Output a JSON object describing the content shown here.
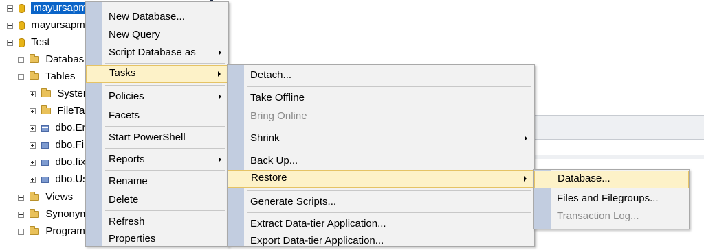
{
  "tree": {
    "rows": [
      {
        "label": "mayursapm",
        "indent": 0,
        "icon": "database-icon",
        "expander": "plus",
        "selected": true
      },
      {
        "label": "mayursapm",
        "indent": 0,
        "icon": "database-icon",
        "expander": "plus"
      },
      {
        "label": "Test",
        "indent": 0,
        "icon": "database-icon",
        "expander": "minus"
      },
      {
        "label": "Database",
        "indent": 1,
        "icon": "folder-icon",
        "expander": "plus"
      },
      {
        "label": "Tables",
        "indent": 1,
        "icon": "folder-icon",
        "expander": "minus"
      },
      {
        "label": "System",
        "indent": 2,
        "icon": "folder-icon",
        "expander": "plus"
      },
      {
        "label": "FileTab",
        "indent": 2,
        "icon": "folder-icon",
        "expander": "plus"
      },
      {
        "label": "dbo.Er",
        "indent": 2,
        "icon": "table-icon",
        "expander": "plus"
      },
      {
        "label": "dbo.Fi",
        "indent": 2,
        "icon": "table-icon",
        "expander": "plus"
      },
      {
        "label": "dbo.fix",
        "indent": 2,
        "icon": "table-icon",
        "expander": "plus"
      },
      {
        "label": "dbo.Us",
        "indent": 2,
        "icon": "table-icon",
        "expander": "plus"
      },
      {
        "label": "Views",
        "indent": 1,
        "icon": "folder-icon",
        "expander": "plus"
      },
      {
        "label": "Synonym",
        "indent": 1,
        "icon": "folder-icon",
        "expander": "plus"
      },
      {
        "label": "Programm",
        "indent": 1,
        "icon": "folder-icon",
        "expander": "plus"
      }
    ]
  },
  "menu1": {
    "items": [
      {
        "label": "New Database..."
      },
      {
        "label": "New Query"
      },
      {
        "label": "Script Database as",
        "submenu": true
      },
      {
        "label": "Tasks",
        "submenu": true,
        "highlighted": true
      },
      {
        "label": "Policies",
        "submenu": true
      },
      {
        "label": "Facets"
      },
      {
        "label": "Start PowerShell"
      },
      {
        "label": "Reports",
        "submenu": true
      },
      {
        "label": "Rename"
      },
      {
        "label": "Delete"
      },
      {
        "label": "Refresh"
      },
      {
        "label": "Properties"
      }
    ]
  },
  "menu2": {
    "items": [
      {
        "label": "Detach..."
      },
      {
        "label": "Take Offline"
      },
      {
        "label": "Bring Online",
        "disabled": true
      },
      {
        "label": "Shrink",
        "submenu": true
      },
      {
        "label": "Back Up..."
      },
      {
        "label": "Restore",
        "submenu": true,
        "highlighted": true
      },
      {
        "label": "Generate Scripts..."
      },
      {
        "label": "Extract Data-tier Application..."
      },
      {
        "label": "Export Data-tier Application..."
      }
    ]
  },
  "menu3": {
    "items": [
      {
        "label": "Database...",
        "highlighted": true
      },
      {
        "label": "Files and Filegroups..."
      },
      {
        "label": "Transaction Log...",
        "disabled": true
      }
    ]
  },
  "colors": {
    "menu_bg": "#f2f2f2",
    "menu_gutter": "#c2cde0",
    "highlight_bg": "#fdf2c8",
    "highlight_border": "#e5c365",
    "selection": "#0a64c8"
  }
}
